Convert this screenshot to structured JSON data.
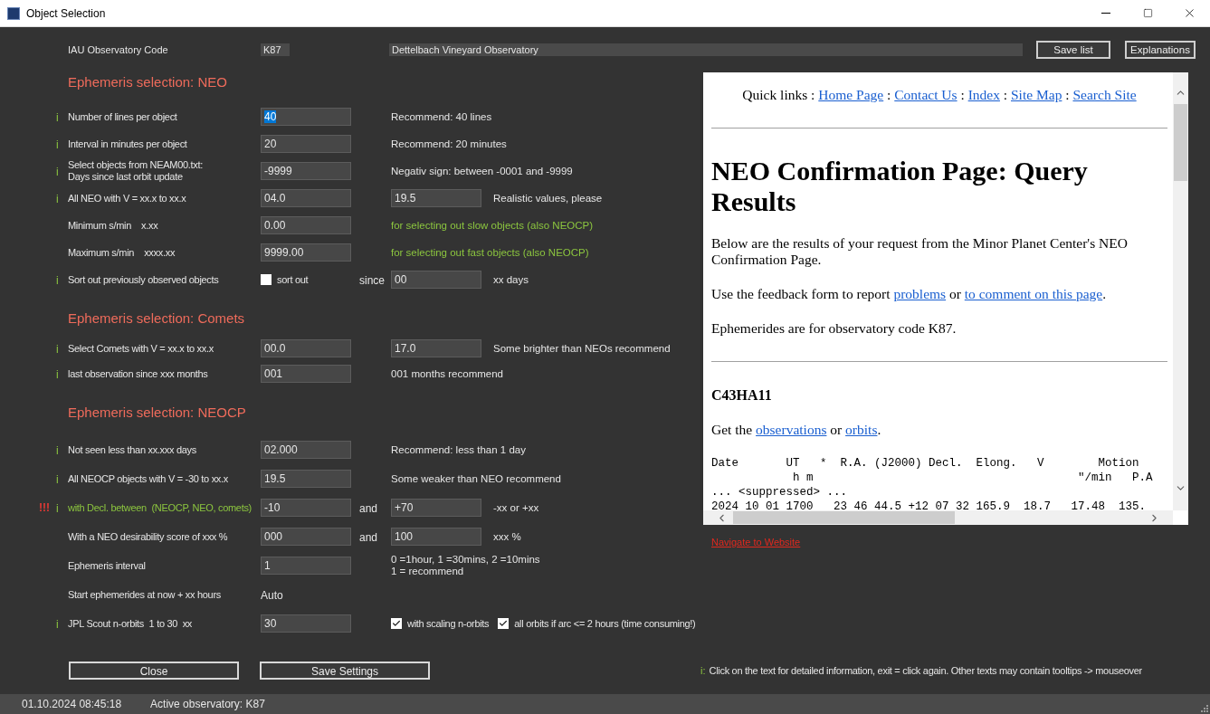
{
  "window": {
    "title": "Object Selection"
  },
  "observatory": {
    "label": "IAU Observatory Code",
    "code": "K87",
    "name": "Dettelbach Vineyard Observatory"
  },
  "toolbar_buttons": [
    "Save list",
    "Explanations"
  ],
  "sections": [
    {
      "title": "Ephemeris selection: NEO",
      "rows": [
        {
          "info_marker": "i",
          "highlight": false,
          "label": "Number of lines per object",
          "value": {
            "kind": "input",
            "text": "40",
            "text_selected": true
          },
          "note": {
            "text": "Recommend: 40 lines",
            "highlight": false
          }
        },
        {
          "info_marker": "i",
          "highlight": false,
          "label": "Interval in minutes per object",
          "value": {
            "kind": "input",
            "text": "20",
            "text_selected": false
          },
          "note": {
            "text": "Recommend: 20 minutes",
            "highlight": false
          }
        },
        {
          "info_marker": "i",
          "highlight": false,
          "label": "Select objects from NEAM00.txt:\nDays since last orbit update",
          "value": {
            "kind": "input",
            "text": "-9999",
            "text_selected": false
          },
          "note": {
            "text": "Negativ sign: between -0001 and -9999",
            "highlight": false
          }
        },
        {
          "info_marker": "i",
          "highlight": false,
          "label": "All NEO with V = xx.x to xx.x",
          "value": {
            "kind": "input",
            "text": "04.0",
            "text_selected": false
          },
          "value2": {
            "kind": "input",
            "text": "19.5",
            "text_selected": false
          },
          "note": {
            "text": "Realistic values, please",
            "highlight": false
          }
        },
        {
          "highlight": false,
          "label": "Minimum s/min    x.xx",
          "value": {
            "kind": "input",
            "text": "0.00",
            "text_selected": false
          },
          "note": {
            "text": "for selecting out slow objects (also NEOCP)",
            "highlight": true
          }
        },
        {
          "highlight": false,
          "label": "Maximum s/min    xxxx.xx",
          "value": {
            "kind": "input",
            "text": "9999.00",
            "text_selected": false
          },
          "note": {
            "text": "for selecting out fast objects (also NEOCP)",
            "highlight": true
          }
        },
        {
          "info_marker": "i",
          "highlight": false,
          "label": "Sort out previously observed objects",
          "value": {
            "kind": "checkbox",
            "text": "sort out",
            "checked": false
          },
          "joiner": "since",
          "value2": {
            "kind": "input",
            "text": "00",
            "text_selected": false
          },
          "note": {
            "text": "xx days",
            "highlight": false
          }
        }
      ]
    },
    {
      "title": "Ephemeris selection: Comets",
      "rows": [
        {
          "info_marker": "i",
          "highlight": false,
          "label": "Select Comets with V = xx.x to xx.x",
          "value": {
            "kind": "input",
            "text": "00.0",
            "text_selected": false
          },
          "value2": {
            "kind": "input",
            "text": "17.0",
            "text_selected": false
          },
          "note": {
            "text": "Some brighter than NEOs recommend",
            "highlight": false
          }
        },
        {
          "info_marker": "i",
          "highlight": false,
          "label": "last observation since xxx months",
          "value": {
            "kind": "input",
            "text": "001",
            "text_selected": false
          },
          "note": {
            "text": "001 months recommend",
            "highlight": false
          }
        }
      ]
    },
    {
      "title": "Ephemeris selection: NEOCP",
      "rows": [
        {
          "info_marker": "i",
          "highlight": false,
          "label": "Not seen less than xx.xxx days",
          "value": {
            "kind": "input",
            "text": "02.000",
            "text_selected": false
          },
          "note": {
            "text": "Recommend: less than 1 day",
            "highlight": false
          }
        },
        {
          "info_marker": "i",
          "highlight": false,
          "label": "All NEOCP objects with V = -30 to xx.x",
          "value": {
            "kind": "input",
            "text": "19.5",
            "text_selected": false
          },
          "note": {
            "text": "Some weaker than NEO recommend",
            "highlight": false
          }
        },
        {
          "alert": "!!!",
          "info_marker": "i",
          "highlight": true,
          "label": "with Decl. between  (NEOCP, NEO, comets)",
          "value": {
            "kind": "input",
            "text": "-10",
            "text_selected": false
          },
          "joiner": "and",
          "value2": {
            "kind": "input",
            "text": "+70",
            "text_selected": false
          },
          "note": {
            "text": "-xx or +xx",
            "highlight": false
          }
        },
        {
          "highlight": false,
          "label": "With a NEO desirability score of xxx %",
          "value": {
            "kind": "input",
            "text": "000",
            "text_selected": false
          },
          "joiner": "and",
          "value2": {
            "kind": "input",
            "text": "100",
            "text_selected": false
          },
          "note": {
            "text": "xxx %",
            "highlight": false
          }
        },
        {
          "highlight": false,
          "label": "Ephemeris interval",
          "value": {
            "kind": "input",
            "text": "1",
            "text_selected": false
          },
          "note": {
            "text": "0 =1hour, 1 =30mins, 2 =10mins\n1 = recommend",
            "highlight": false
          }
        },
        {
          "highlight": false,
          "label": "Start ephemerides at now + xx hours",
          "value": {
            "kind": "text",
            "text": "Auto"
          }
        },
        {
          "info_marker": "i",
          "highlight": false,
          "label": "JPL Scout n-orbits  1 to 30  xx",
          "value": {
            "kind": "input",
            "text": "30",
            "text_selected": false
          },
          "options": [
            {
              "text": "with scaling n-orbits",
              "checked": true
            },
            {
              "text": "all orbits if arc <= 2 hours (time consuming!)",
              "checked": true
            }
          ]
        }
      ]
    }
  ],
  "web_view": {
    "quick_links": [
      {
        "kind": "text",
        "text": "Quick links : "
      },
      {
        "kind": "link",
        "text": "Home Page"
      },
      {
        "kind": "text",
        "text": " : "
      },
      {
        "kind": "link",
        "text": "Contact Us"
      },
      {
        "kind": "text",
        "text": " : "
      },
      {
        "kind": "link",
        "text": "Index"
      },
      {
        "kind": "text",
        "text": " : "
      },
      {
        "kind": "link",
        "text": "Site Map"
      },
      {
        "kind": "text",
        "text": " : "
      },
      {
        "kind": "link",
        "text": "Search Site"
      }
    ],
    "title": "NEO Confirmation Page: Query Results",
    "paragraphs": [
      [
        {
          "kind": "text",
          "text": "Below are the results of your request from the Minor Planet Center's NEO Confirmation Page."
        }
      ],
      [
        {
          "kind": "text",
          "text": "Use the feedback form to report "
        },
        {
          "kind": "link",
          "text": "problems"
        },
        {
          "kind": "text",
          "text": " or "
        },
        {
          "kind": "link",
          "text": "to comment on this page"
        },
        {
          "kind": "text",
          "text": "."
        }
      ],
      [
        {
          "kind": "text",
          "text": "Ephemerides are for observatory code K87."
        }
      ]
    ],
    "object": "C43HA11",
    "object_links": [
      {
        "kind": "text",
        "text": "Get the "
      },
      {
        "kind": "link",
        "text": "observations"
      },
      {
        "kind": "text",
        "text": " or "
      },
      {
        "kind": "link",
        "text": "orbits"
      },
      {
        "kind": "text",
        "text": "."
      }
    ],
    "ephemeris_lines": [
      "Date       UT   *  R.A. (J2000) Decl.  Elong.   V        Motion",
      "            h m                                       \"/min   P.A",
      "... <suppressed> ...",
      "2024 10 01 1700   23 46 44.5 +12 07 32 165.9  18.7   17.48  135."
    ]
  },
  "navigate_link": "Navigate to Website",
  "buttons": [
    "Close",
    "Save Settings"
  ],
  "footer": {
    "marker": "i:",
    "text": "Click on the text for detailed information, exit = click again. Other texts may contain tooltips -> mouseover"
  },
  "status_bar": {
    "time": "01.10.2024 08:45:18",
    "observatory": "Active observatory: K87"
  }
}
